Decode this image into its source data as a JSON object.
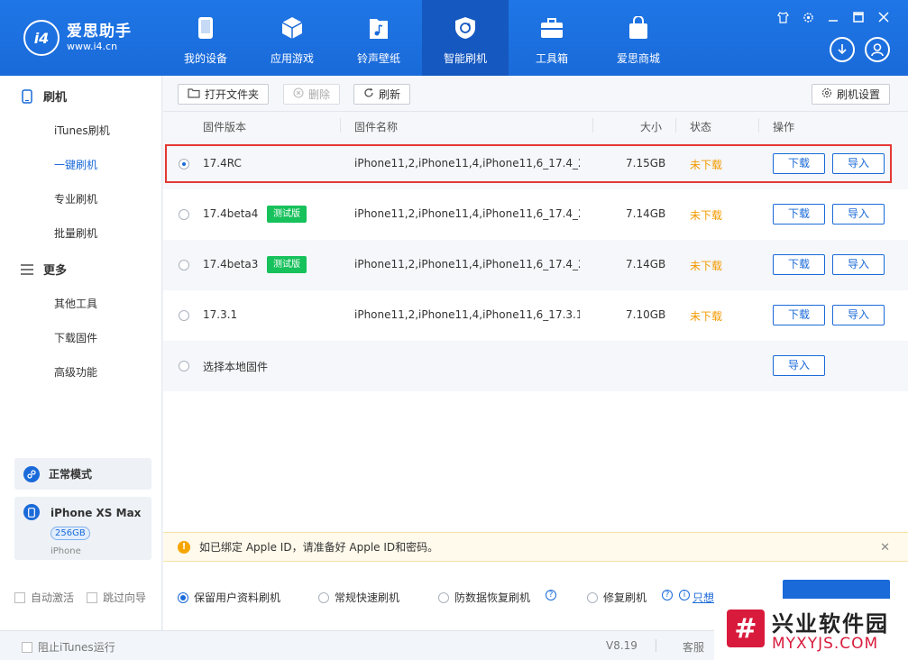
{
  "app": {
    "name": "爱思助手",
    "url": "www.i4.cn",
    "logo_mark": "i4"
  },
  "nav": [
    {
      "label": "我的设备",
      "icon": "phone-icon"
    },
    {
      "label": "应用游戏",
      "icon": "cube-icon"
    },
    {
      "label": "铃声壁纸",
      "icon": "music-file-icon"
    },
    {
      "label": "智能刷机",
      "icon": "refresh-shield-icon",
      "active": true
    },
    {
      "label": "工具箱",
      "icon": "toolbox-icon"
    },
    {
      "label": "爱思商城",
      "icon": "shopping-bag-icon"
    }
  ],
  "sidebar": {
    "section_flash": "刷机",
    "flash_items": [
      "iTunes刷机",
      "一键刷机",
      "专业刷机",
      "批量刷机"
    ],
    "active_item": "一键刷机",
    "section_more": "更多",
    "more_items": [
      "其他工具",
      "下载固件",
      "高级功能"
    ],
    "mode": "正常模式",
    "device": {
      "name": "iPhone XS Max",
      "capacity": "256GB",
      "type": "iPhone"
    },
    "auto_activate": "自动激活",
    "skip_guide": "跳过向导"
  },
  "toolbar": {
    "open_folder": "打开文件夹",
    "delete": "删除",
    "refresh": "刷新",
    "settings": "刷机设置"
  },
  "table": {
    "headers": {
      "version": "固件版本",
      "name": "固件名称",
      "size": "大小",
      "status": "状态",
      "action": "操作"
    },
    "rows": [
      {
        "version": "17.4RC",
        "beta": "",
        "name": "iPhone11,2,iPhone11,4,iPhone11,6_17.4_2...",
        "size": "7.15GB",
        "status": "未下载",
        "download": "下载",
        "import": "导入",
        "checked": true
      },
      {
        "version": "17.4beta4",
        "beta": "测试版",
        "name": "iPhone11,2,iPhone11,4,iPhone11,6_17.4_2...",
        "size": "7.14GB",
        "status": "未下载",
        "download": "下载",
        "import": "导入"
      },
      {
        "version": "17.4beta3",
        "beta": "测试版",
        "name": "iPhone11,2,iPhone11,4,iPhone11,6_17.4_2...",
        "size": "7.14GB",
        "status": "未下载",
        "download": "下载",
        "import": "导入"
      },
      {
        "version": "17.3.1",
        "beta": "",
        "name": "iPhone11,2,iPhone11,4,iPhone11,6_17.3.1...",
        "size": "7.10GB",
        "status": "未下载",
        "download": "下载",
        "import": "导入"
      }
    ],
    "local": {
      "label": "选择本地固件",
      "import": "导入"
    }
  },
  "notice": "如已绑定 Apple ID，请准备好 Apple ID和密码。",
  "options": {
    "keep_data": "保留用户资料刷机",
    "quick": "常规快速刷机",
    "anti_recovery": "防数据恢复刷机",
    "repair": "修复刷机",
    "link_text": "只想"
  },
  "footer": {
    "block_itunes": "阻止iTunes运行",
    "version": "V8.19",
    "service": "客服"
  },
  "watermark": {
    "title": "兴业软件园",
    "url": "MYXYJS.COM"
  },
  "colors": {
    "primary": "#1a6ad9",
    "status": "#f39a00",
    "beta": "#17c15b",
    "highlight": "#e53935"
  }
}
